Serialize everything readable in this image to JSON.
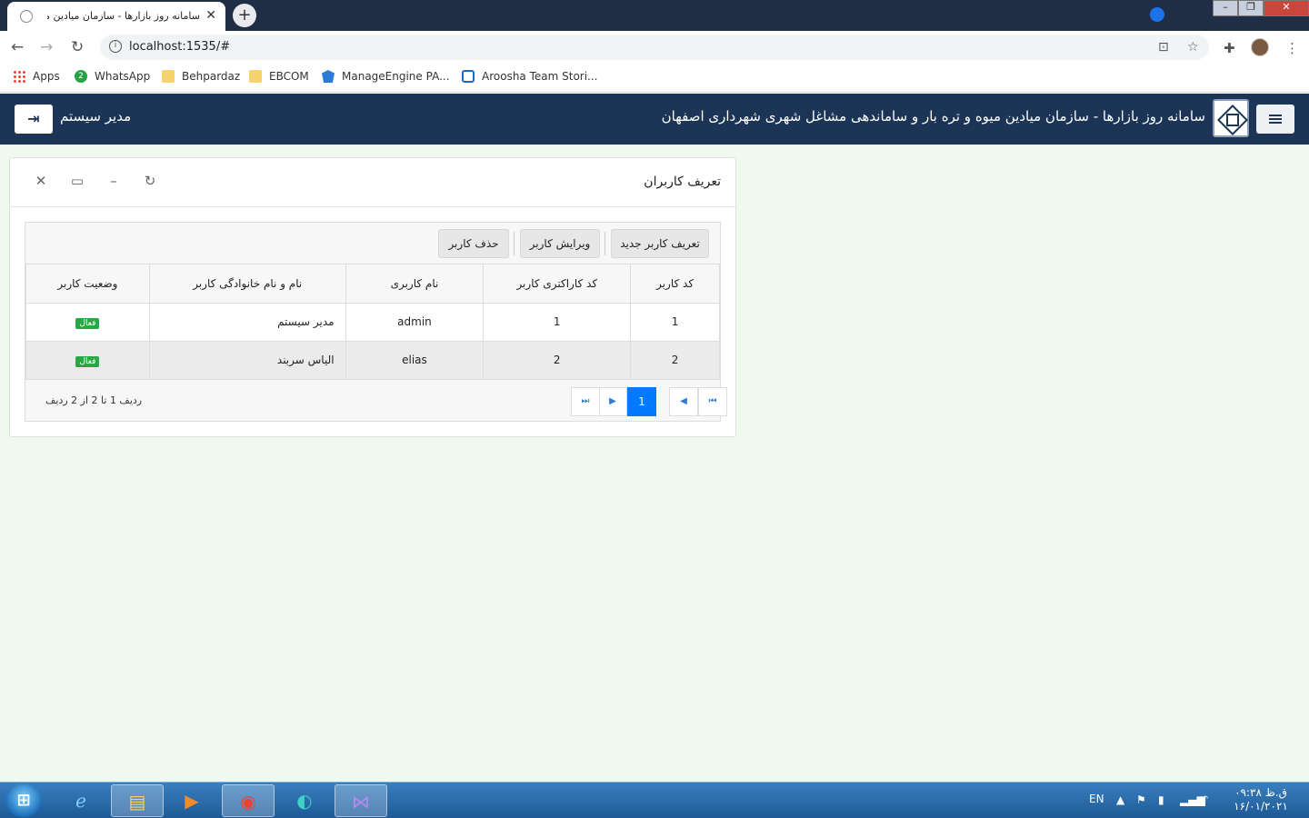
{
  "browser": {
    "tab_title": "سامانه روز بازارها - سازمان میادین میوه و",
    "tab_close": "✕",
    "new_tab": "+",
    "url": "localhost:1535/#",
    "bookmarks": [
      {
        "label": "Apps",
        "icon": "apps-grid-icon"
      },
      {
        "label": "WhatsApp",
        "icon": "whatsapp-icon"
      },
      {
        "label": "Behpardaz",
        "icon": "folder-icon"
      },
      {
        "label": "EBCOM",
        "icon": "folder-icon"
      },
      {
        "label": "ManageEngine PA...",
        "icon": "manageengine-icon"
      },
      {
        "label": "Aroosha Team Stori...",
        "icon": "azure-devops-icon"
      }
    ]
  },
  "header": {
    "title": "سامانه روز بازارها - سازمان میادین میوه و تره بار و ساماندهی مشاغل شهری شهرداری اصفهان",
    "user": "مدیر سیستم",
    "color": "#1c3557"
  },
  "panel": {
    "title": "تعریف کاربران",
    "toolbar": {
      "new_user": "تعریف کاربر جدید",
      "edit_user": "ویرایش کاربر",
      "delete_user": "حذف کاربر"
    },
    "columns": [
      "کد کاربر",
      "کد کاراکتری کاربر",
      "نام کاربری",
      "نام و نام خانوادگی کاربر",
      "وضعیت کاربر"
    ],
    "rows": [
      {
        "id": "1",
        "char_code": "1",
        "username": "admin",
        "full_name": "مدیر سیستم",
        "status": "فعال"
      },
      {
        "id": "2",
        "char_code": "2",
        "username": "elias",
        "full_name": "الیاس سربند",
        "status": "فعال"
      }
    ],
    "pager": {
      "current_page": "1",
      "info": "ردیف 1 تا 2 از 2 ردیف"
    }
  },
  "taskbar": {
    "lang": "EN",
    "time": "۰۹:۳۸ ق.ظ",
    "date": "۱۶/۰۱/۲۰۲۱"
  }
}
